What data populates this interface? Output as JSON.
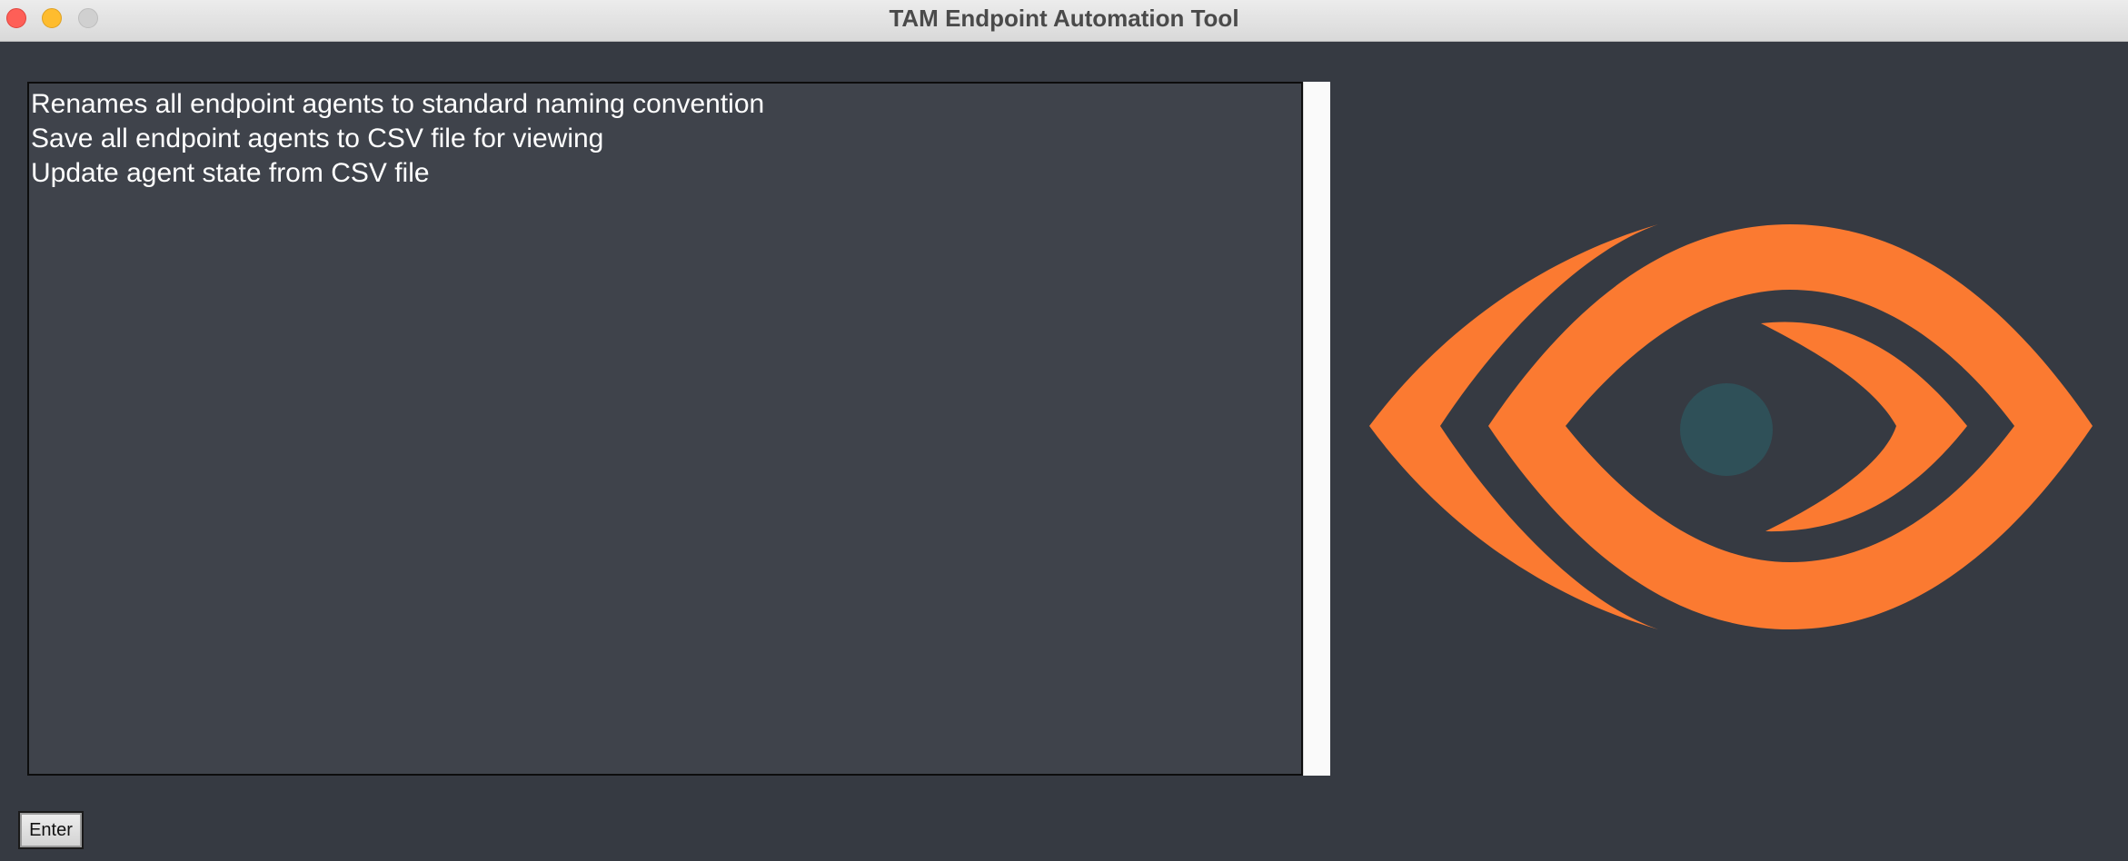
{
  "window": {
    "title": "TAM Endpoint Automation Tool"
  },
  "options_list": {
    "items": [
      {
        "label": "Renames all endpoint agents to standard naming convention"
      },
      {
        "label": "Save all endpoint agents to CSV file for viewing"
      },
      {
        "label": "Update agent state from CSV file"
      }
    ]
  },
  "actions": {
    "enter_label": "Enter"
  },
  "logo": {
    "icon": "eye-logo-icon",
    "colors": {
      "primary": "#fb7a31",
      "pupil": "#2f5058",
      "background": "#363a42"
    }
  },
  "colors": {
    "window_background": "#363a42",
    "list_background": "#3f434b",
    "list_text": "#ffffff"
  }
}
